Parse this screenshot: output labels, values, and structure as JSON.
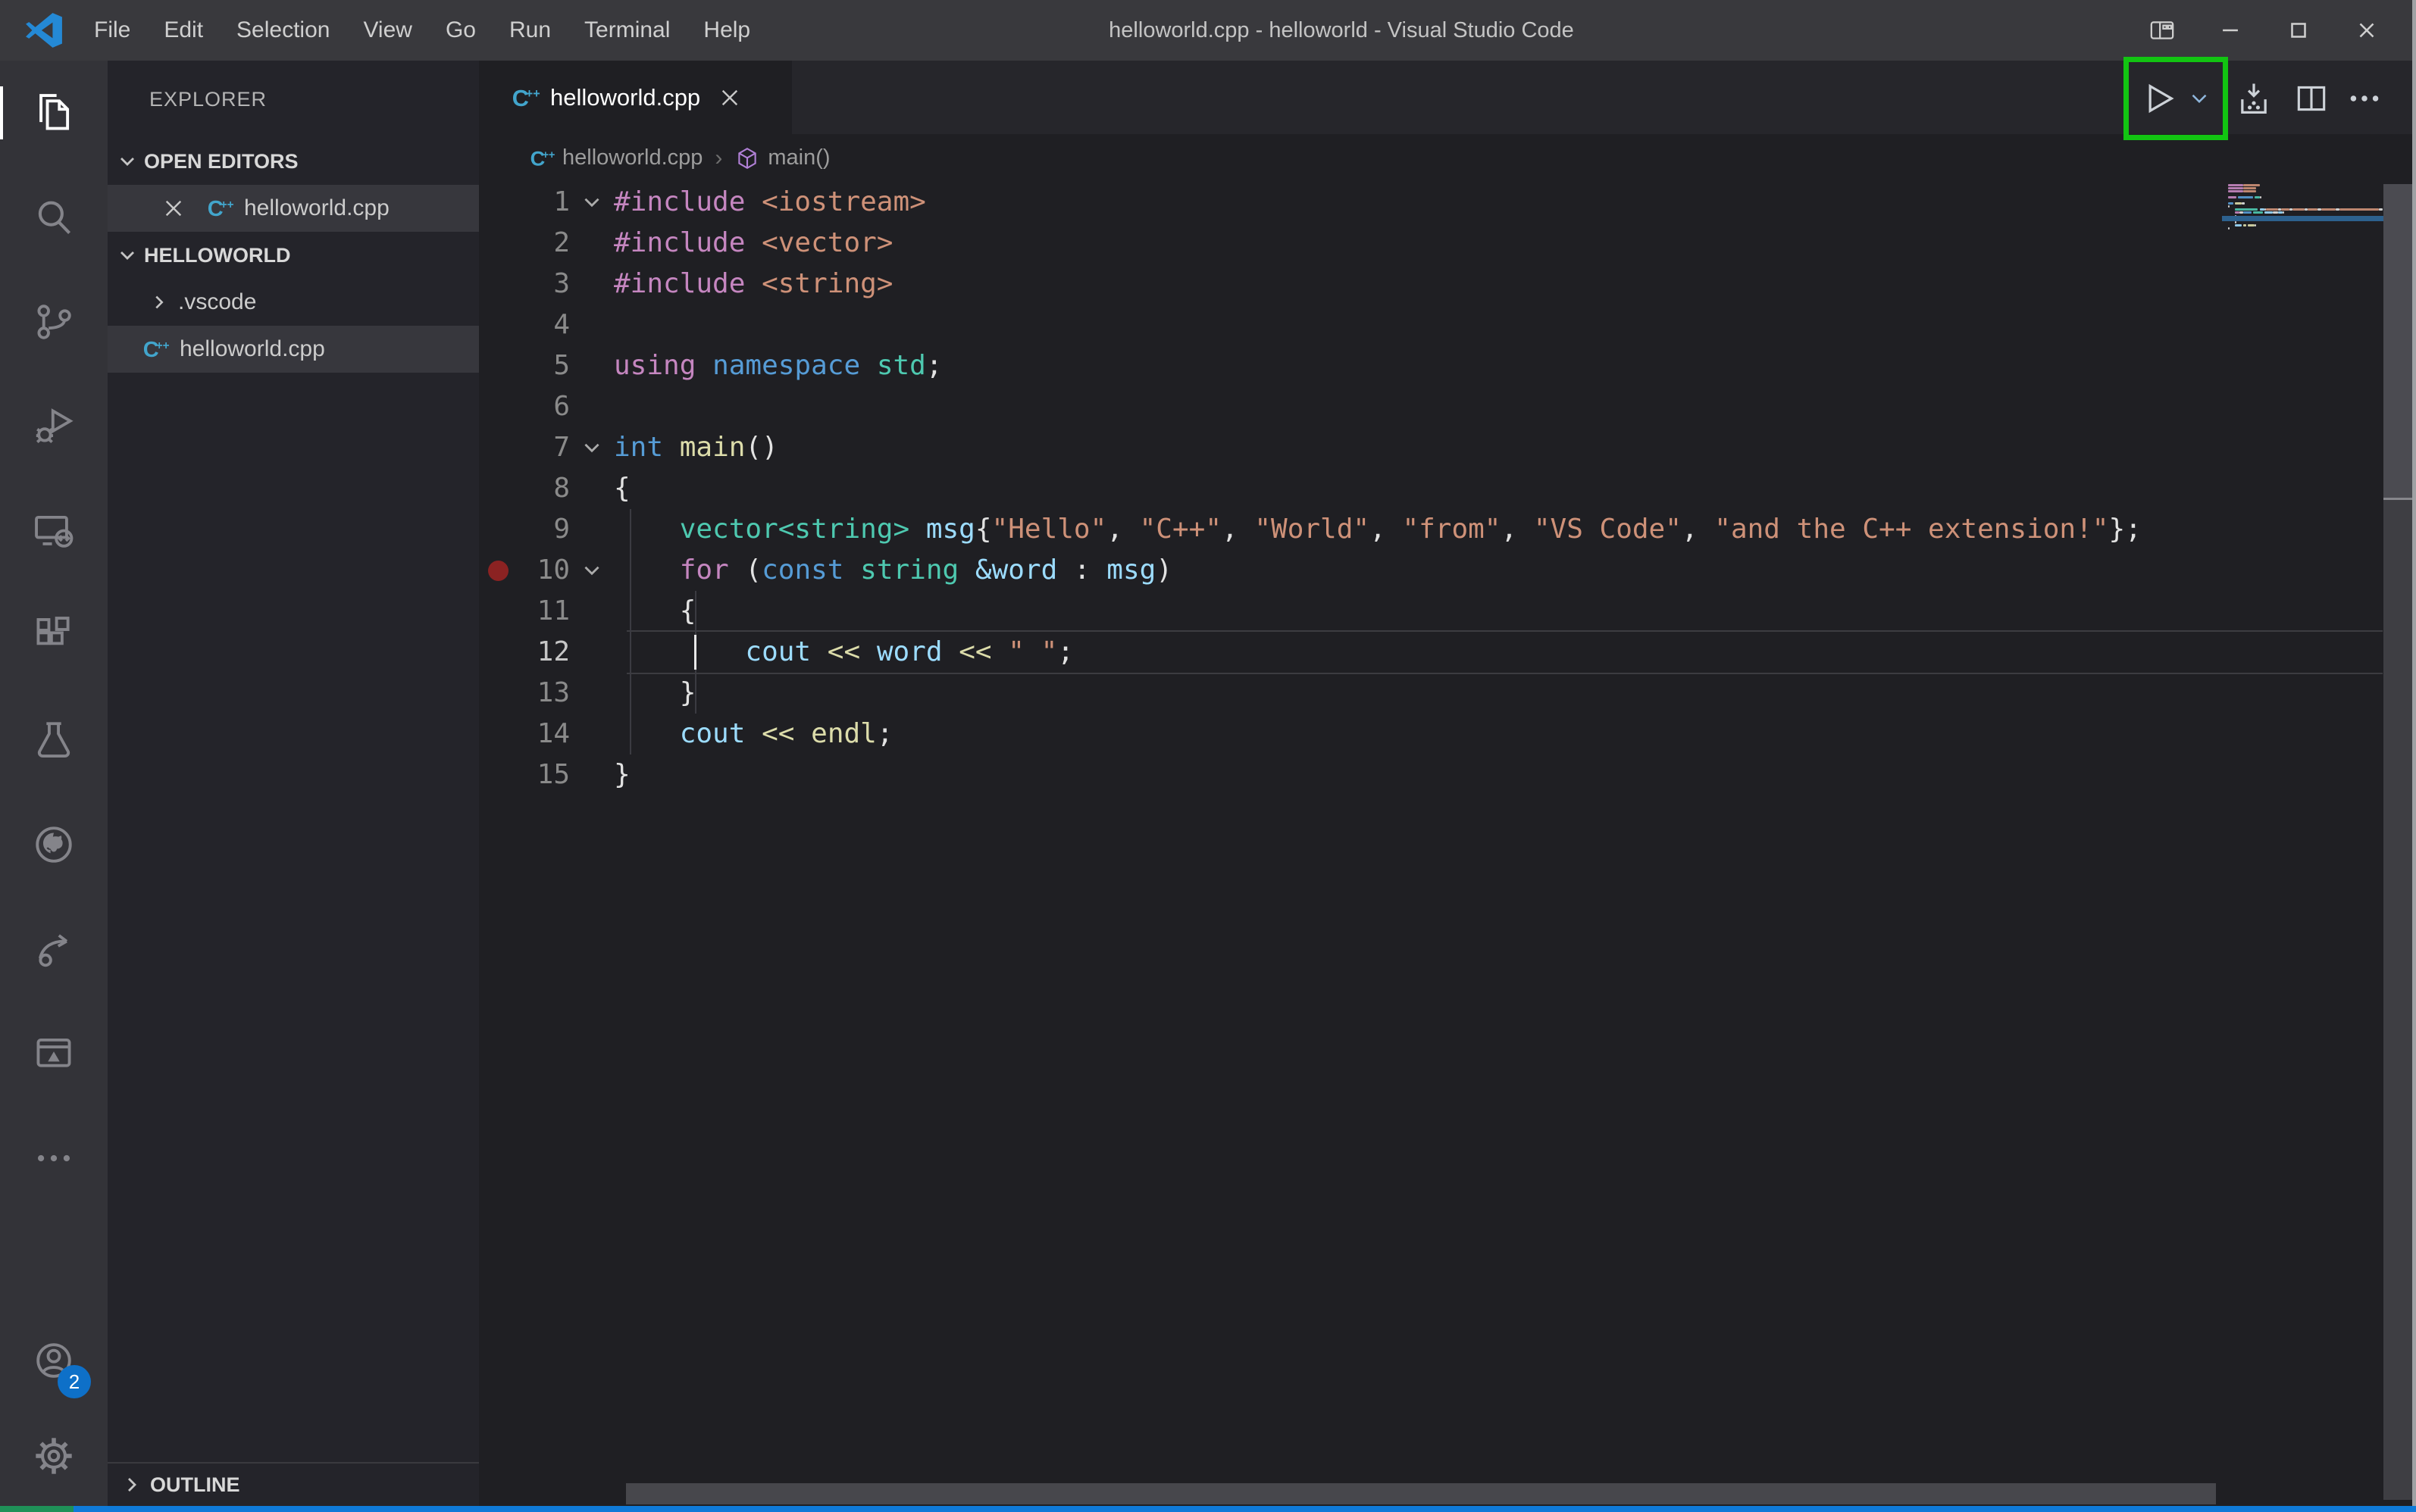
{
  "titlebar": {
    "title": "helloworld.cpp - helloworld - Visual Studio Code",
    "menus": [
      "File",
      "Edit",
      "Selection",
      "View",
      "Go",
      "Run",
      "Terminal",
      "Help"
    ],
    "window_controls": [
      "customize-layout",
      "minimize",
      "maximize",
      "close"
    ]
  },
  "activity_bar": {
    "items": [
      "explorer",
      "search",
      "source-control",
      "run-and-debug",
      "remote-explorer",
      "extensions",
      "testing",
      "github",
      "live-share",
      "live-preview",
      "more-views"
    ],
    "active_item": "explorer",
    "accounts_badge": "2"
  },
  "sidebar": {
    "header": "EXPLORER",
    "open_editors_label": "OPEN EDITORS",
    "folder_label": "HELLOWORLD",
    "outline_label": "OUTLINE",
    "open_editors": [
      {
        "file": "helloworld.cpp",
        "selected": true
      }
    ],
    "tree": [
      {
        "label": ".vscode",
        "type": "folder-collapsed"
      },
      {
        "label": "helloworld.cpp",
        "type": "cpp-file",
        "selected": true
      }
    ]
  },
  "editor": {
    "tab": {
      "label": "helloworld.cpp"
    },
    "breadcrumb": {
      "file": "helloworld.cpp",
      "symbol": "main()"
    },
    "current_line": 12,
    "cursor": {
      "line": 12,
      "col": 4
    },
    "breakpoint_lines": [
      10
    ],
    "code": {
      "language": "cpp",
      "lines": [
        {
          "n": 1,
          "fold": true,
          "tokens": [
            [
              "#include ",
              "pp"
            ],
            [
              "<iostream>",
              "str"
            ]
          ]
        },
        {
          "n": 2,
          "tokens": [
            [
              "#include ",
              "pp"
            ],
            [
              "<vector>",
              "str"
            ]
          ]
        },
        {
          "n": 3,
          "tokens": [
            [
              "#include ",
              "pp"
            ],
            [
              "<string>",
              "str"
            ]
          ]
        },
        {
          "n": 4,
          "tokens": []
        },
        {
          "n": 5,
          "tokens": [
            [
              "using",
              "pp"
            ],
            [
              " ",
              "ws"
            ],
            [
              "namespace",
              "kw"
            ],
            [
              " ",
              "ws"
            ],
            [
              "std",
              "type"
            ],
            [
              ";",
              "pl"
            ]
          ]
        },
        {
          "n": 6,
          "tokens": []
        },
        {
          "n": 7,
          "fold": true,
          "tokens": [
            [
              "int",
              "kw"
            ],
            [
              " ",
              "ws"
            ],
            [
              "main",
              "fn"
            ],
            [
              "()",
              "pl"
            ]
          ]
        },
        {
          "n": 8,
          "tokens": [
            [
              "{",
              "pl"
            ]
          ]
        },
        {
          "n": 9,
          "tokens": [
            [
              "    ",
              "ws"
            ],
            [
              "vector<string>",
              "type"
            ],
            [
              " ",
              "ws"
            ],
            [
              "msg",
              "var"
            ],
            [
              "{",
              "pl"
            ],
            [
              "\"Hello\"",
              "str"
            ],
            [
              ", ",
              "pl"
            ],
            [
              "\"C++\"",
              "str"
            ],
            [
              ", ",
              "pl"
            ],
            [
              "\"World\"",
              "str"
            ],
            [
              ", ",
              "pl"
            ],
            [
              "\"from\"",
              "str"
            ],
            [
              ", ",
              "pl"
            ],
            [
              "\"VS Code\"",
              "str"
            ],
            [
              ", ",
              "pl"
            ],
            [
              "\"and the C++ extension!\"",
              "str"
            ],
            [
              "};",
              "pl"
            ]
          ]
        },
        {
          "n": 10,
          "fold": true,
          "tokens": [
            [
              "    ",
              "ws"
            ],
            [
              "for",
              "pp"
            ],
            [
              " (",
              "pl"
            ],
            [
              "const",
              "kw"
            ],
            [
              " ",
              "ws"
            ],
            [
              "string",
              "type"
            ],
            [
              " ",
              "ws"
            ],
            [
              "&word",
              "var"
            ],
            [
              " : ",
              "pl"
            ],
            [
              "msg",
              "var"
            ],
            [
              ")",
              "pl"
            ]
          ]
        },
        {
          "n": 11,
          "tokens": [
            [
              "    ",
              "ws"
            ],
            [
              "{",
              "pl"
            ]
          ]
        },
        {
          "n": 12,
          "tokens": [
            [
              "        ",
              "ws"
            ],
            [
              "cout",
              "var"
            ],
            [
              " ",
              "ws"
            ],
            [
              "<<",
              "fn"
            ],
            [
              " ",
              "ws"
            ],
            [
              "word",
              "var"
            ],
            [
              " ",
              "ws"
            ],
            [
              "<<",
              "fn"
            ],
            [
              " ",
              "ws"
            ],
            [
              "\" \"",
              "str"
            ],
            [
              ";",
              "pl"
            ]
          ]
        },
        {
          "n": 13,
          "tokens": [
            [
              "    ",
              "ws"
            ],
            [
              "}",
              "pl"
            ]
          ]
        },
        {
          "n": 14,
          "tokens": [
            [
              "    ",
              "ws"
            ],
            [
              "cout",
              "var"
            ],
            [
              " ",
              "ws"
            ],
            [
              "<<",
              "fn"
            ],
            [
              " ",
              "ws"
            ],
            [
              "endl",
              "fn"
            ],
            [
              ";",
              "pl"
            ]
          ]
        },
        {
          "n": 15,
          "tokens": [
            [
              "}",
              "pl"
            ]
          ]
        }
      ]
    },
    "actions": [
      "run-cpp-file",
      "run-dropdown",
      "install",
      "split-editor",
      "more-actions"
    ]
  },
  "annotation": {
    "highlight": "run-button",
    "color": "#12c412"
  },
  "colors": {
    "accent_blue": "#0f7ad8",
    "remote_green": "#1f9158",
    "breakpoint_red": "#8b2222",
    "tokens": {
      "pp": "#C586C0",
      "str": "#CE9178",
      "kw": "#569CD6",
      "type": "#4EC9B0",
      "fn": "#DCDCAA",
      "var": "#9CDCFE",
      "pl": "#E2E2E2"
    }
  }
}
